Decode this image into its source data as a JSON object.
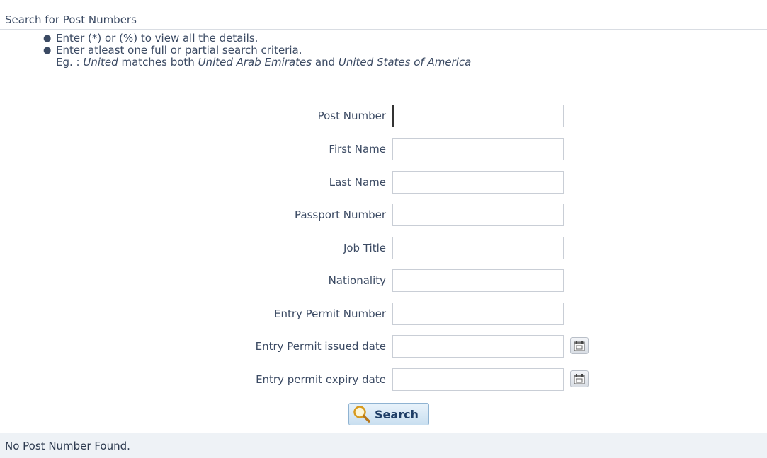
{
  "section": {
    "title": "Search for Post Numbers"
  },
  "instructions": {
    "items": [
      "Enter (*) or (%) to view all the details.",
      "Enter atleast one full or partial search criteria."
    ],
    "example": {
      "lead": "Eg. :",
      "term": "United",
      "middle": "matches both",
      "match1": "United Arab Emirates",
      "and": "and",
      "match2": "United States of America"
    }
  },
  "form": {
    "fields": [
      {
        "label": "Post Number",
        "value": ""
      },
      {
        "label": "First Name",
        "value": ""
      },
      {
        "label": "Last Name",
        "value": ""
      },
      {
        "label": "Passport Number",
        "value": ""
      },
      {
        "label": "Job Title",
        "value": ""
      },
      {
        "label": "Nationality",
        "value": ""
      },
      {
        "label": "Entry Permit Number",
        "value": ""
      },
      {
        "label": "Entry Permit issued date",
        "value": "",
        "icon": "calendar-icon"
      },
      {
        "label": "Entry permit expiry date",
        "value": "",
        "icon": "calendar-icon"
      }
    ],
    "search_label": "Search",
    "search_icon": "magnifier-icon"
  },
  "status": {
    "message": "No Post Number Found."
  },
  "colors": {
    "text": "#3b4a63",
    "button_border": "#8fb3d2",
    "status_bg": "#eef2f6"
  }
}
